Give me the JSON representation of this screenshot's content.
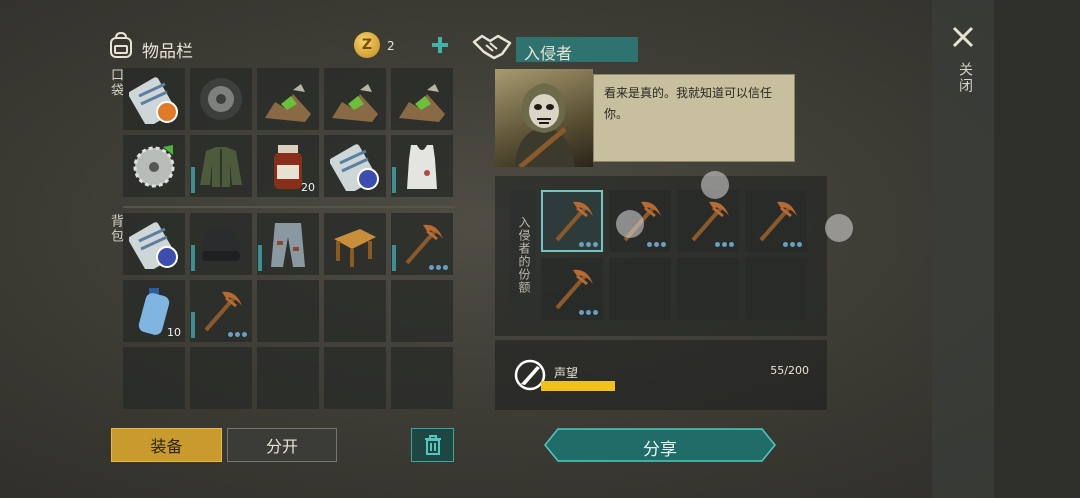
{
  "inventory": {
    "title": "物品栏",
    "currency_amount": "2",
    "pocket_label": "口袋",
    "backpack_label": "背包",
    "pocket_slots": [
      {
        "icon": "map-scroll-icon",
        "badge": "orange"
      },
      {
        "icon": "tire-icon"
      },
      {
        "icon": "ore-pile-icon"
      },
      {
        "icon": "ore-pile-icon"
      },
      {
        "icon": "ore-pile-icon"
      },
      {
        "icon": "saw-blade-icon"
      },
      {
        "icon": "jacket-icon",
        "bar": true
      },
      {
        "icon": "medicine-bottle-icon",
        "qty": "20"
      },
      {
        "icon": "map-scroll-icon",
        "badge": "blue"
      },
      {
        "icon": "tank-top-icon",
        "bar": true
      }
    ],
    "backpack_slots": [
      {
        "icon": "map-scroll-icon",
        "badge": "blue"
      },
      {
        "icon": "beanie-icon",
        "bar": true
      },
      {
        "icon": "pants-icon",
        "bar": true
      },
      {
        "icon": "workbench-icon"
      },
      {
        "icon": "pickaxe-icon",
        "bar": true,
        "dots": true
      },
      {
        "icon": "water-bottle-icon",
        "qty": "10"
      },
      {
        "icon": "pickaxe-icon",
        "bar": true,
        "dots": true
      },
      {},
      {},
      {},
      {},
      {},
      {},
      {},
      {}
    ],
    "equip_label": "装备",
    "split_label": "分开"
  },
  "trade": {
    "title": "入侵者",
    "dialog": "看来是真的。我就知道可以信任你。",
    "share_panel_label": "入侵者的份额",
    "share_slots": [
      {
        "icon": "pickaxe-icon",
        "selected": true
      },
      {
        "icon": "pickaxe-icon"
      },
      {
        "icon": "pickaxe-icon"
      },
      {
        "icon": "pickaxe-icon"
      },
      {
        "icon": "pickaxe-icon"
      },
      {},
      {},
      {}
    ],
    "reputation_label": "声望",
    "reputation_value": "55/200",
    "reputation_fraction": 0.275,
    "share_button": "分享"
  },
  "close_label": "关闭",
  "colors": {
    "accent": "#3aa5a0",
    "gold": "#d6a33a",
    "reputation_bar": "#f2c21c"
  }
}
